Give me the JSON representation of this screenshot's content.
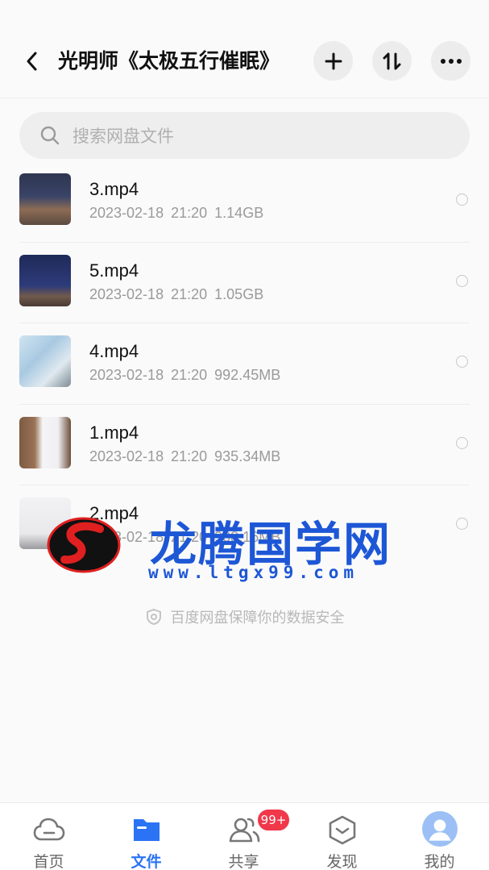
{
  "header": {
    "title": "光明师《太极五行催眠》",
    "back_icon": "chevron-left-icon",
    "add_icon": "plus-icon",
    "sort_icon": "sort-icon",
    "more_icon": "more-icon"
  },
  "search": {
    "placeholder": "搜索网盘文件"
  },
  "files": [
    {
      "name": "3.mp4",
      "date": "2023-02-18",
      "time": "21:20",
      "size": "1.14GB"
    },
    {
      "name": "5.mp4",
      "date": "2023-02-18",
      "time": "21:20",
      "size": "1.05GB"
    },
    {
      "name": "4.mp4",
      "date": "2023-02-18",
      "time": "21:20",
      "size": "992.45MB"
    },
    {
      "name": "1.mp4",
      "date": "2023-02-18",
      "time": "21:20",
      "size": "935.34MB"
    },
    {
      "name": "2.mp4",
      "date": "2023-02-18",
      "time": "21:20",
      "size": "908.16MB"
    }
  ],
  "watermark": {
    "text": "龙腾国学网",
    "url": "www.ltgx99.com"
  },
  "safety_note": "百度网盘保障你的数据安全",
  "bottom_nav": {
    "items": [
      {
        "label": "首页",
        "icon": "cloud-icon"
      },
      {
        "label": "文件",
        "icon": "folder-icon"
      },
      {
        "label": "共享",
        "icon": "people-icon"
      },
      {
        "label": "发现",
        "icon": "cube-icon"
      },
      {
        "label": "我的",
        "icon": "avatar-icon"
      }
    ],
    "active": "文件",
    "share_badge": "99+"
  },
  "colors": {
    "accent": "#2a73f5",
    "badge": "#f0384a",
    "watermark": "#1d57d6"
  }
}
